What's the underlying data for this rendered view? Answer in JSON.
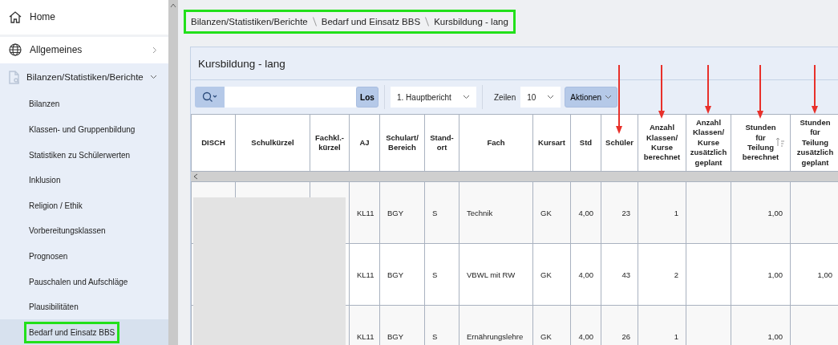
{
  "sidebar": {
    "items": [
      {
        "kind": "home",
        "label": "Home"
      },
      {
        "kind": "globe",
        "label": "Allgemeines",
        "expanded": false
      },
      {
        "kind": "report",
        "label": "Bilanzen/Statistiken/Berichte",
        "expanded": true,
        "children": [
          {
            "label": "Bilanzen",
            "selected": false,
            "annotated": false
          },
          {
            "label": "Klassen- und Gruppenbildung",
            "selected": false,
            "annotated": false
          },
          {
            "label": "Statistiken zu Schülerwerten",
            "selected": false,
            "annotated": false
          },
          {
            "label": "Inklusion",
            "selected": false,
            "annotated": false
          },
          {
            "label": "Religion / Ethik",
            "selected": false,
            "annotated": false
          },
          {
            "label": "Vorbereitungsklassen",
            "selected": false,
            "annotated": false
          },
          {
            "label": "Prognosen",
            "selected": false,
            "annotated": false
          },
          {
            "label": "Pauschalen und Aufschläge",
            "selected": false,
            "annotated": false
          },
          {
            "label": "Plausibilitäten",
            "selected": false,
            "annotated": false
          },
          {
            "label": "Bedarf und Einsatz BBS",
            "selected": true,
            "annotated": true
          }
        ]
      }
    ]
  },
  "breadcrumb": {
    "annotated": true,
    "items": [
      "Bilanzen/Statistiken/Berichte",
      "Bedarf und Einsatz BBS",
      "Kursbildung - lang"
    ]
  },
  "card": {
    "title": "Kursbildung - lang"
  },
  "toolbar": {
    "search_button": "Los",
    "report_select": "1. Hauptbericht",
    "rows_label": "Zeilen",
    "rows_select": "10",
    "actions_button": "Aktionen"
  },
  "table": {
    "redacted": true,
    "columns": [
      {
        "label": "DISCH",
        "arrow": false,
        "sorted": false
      },
      {
        "label": "Schulkürzel",
        "arrow": false,
        "sorted": false
      },
      {
        "label": "Fachkl.-\nkürzel",
        "arrow": false,
        "sorted": false
      },
      {
        "label": "AJ",
        "arrow": false,
        "sorted": false
      },
      {
        "label": "Schulart/\nBereich",
        "arrow": false,
        "sorted": false
      },
      {
        "label": "Stand-\nort",
        "arrow": false,
        "sorted": false
      },
      {
        "label": "Fach",
        "arrow": false,
        "sorted": false
      },
      {
        "label": "Kursart",
        "arrow": false,
        "sorted": false
      },
      {
        "label": "Std",
        "arrow": false,
        "sorted": false
      },
      {
        "label": "Schüler",
        "arrow": true,
        "sorted": false
      },
      {
        "label": "Anzahl\nKlassen/\nKurse\nberechnet",
        "arrow": true,
        "sorted": false
      },
      {
        "label": "Anzahl\nKlassen/\nKurse\nzusätzlich\ngeplant",
        "arrow": true,
        "sorted": false
      },
      {
        "label": "Stunden\nfür\nTeilung\nberechnet",
        "arrow": true,
        "sorted": true
      },
      {
        "label": "Stunden\nfür\nTeilung\nzusätzlich\ngeplant",
        "arrow": true,
        "sorted": false
      }
    ],
    "rows": [
      {
        "cells": [
          null,
          null,
          null,
          "KL11",
          "BGY",
          "S",
          "Technik",
          "GK",
          "4,00",
          "23",
          "1",
          null,
          "1,00",
          null
        ]
      },
      {
        "cells": [
          null,
          null,
          null,
          "KL11",
          "BGY",
          "S",
          "VBWL mit RW",
          "GK",
          "4,00",
          "43",
          "2",
          null,
          "1,00",
          "1,00"
        ]
      },
      {
        "cells": [
          null,
          null,
          null,
          "KL11",
          "BGY",
          "S",
          "Ernährungslehre",
          "GK",
          "4,00",
          "26",
          "1",
          null,
          "1,00",
          null
        ]
      }
    ]
  }
}
